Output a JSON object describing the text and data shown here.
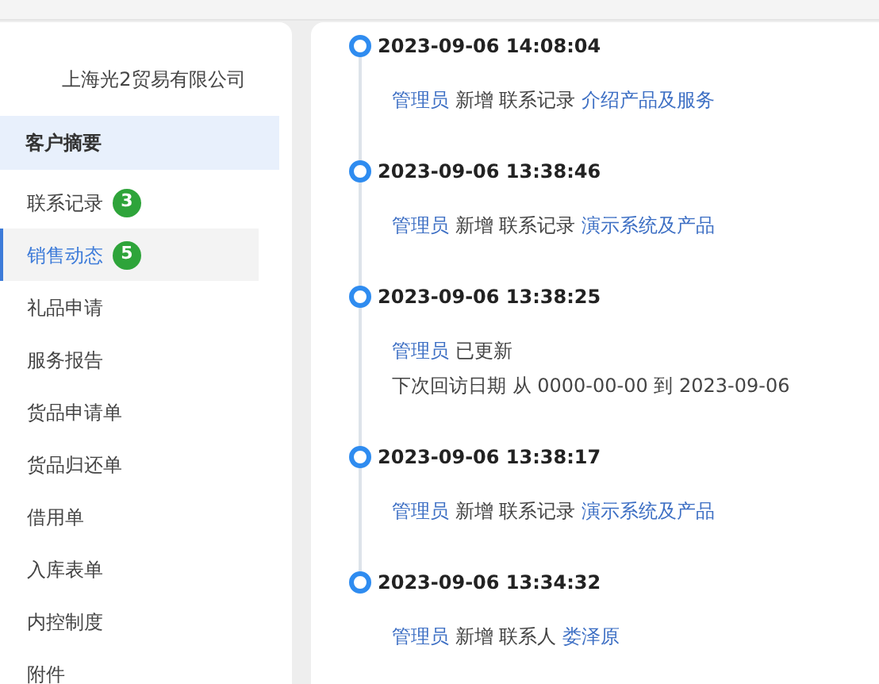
{
  "sidebar": {
    "company": "上海光2贸易有限公司",
    "summary": "客户摘要",
    "items": [
      {
        "label": "联系记录",
        "badge": "3",
        "selected": false
      },
      {
        "label": "销售动态",
        "badge": "5",
        "selected": true
      },
      {
        "label": "礼品申请",
        "selected": false
      },
      {
        "label": "服务报告",
        "selected": false
      },
      {
        "label": "货品申请单",
        "selected": false
      },
      {
        "label": "货品归还单",
        "selected": false
      },
      {
        "label": "借用单",
        "selected": false
      },
      {
        "label": "入库表单",
        "selected": false
      },
      {
        "label": "内控制度",
        "selected": false
      },
      {
        "label": "附件",
        "selected": false
      }
    ]
  },
  "timeline": [
    {
      "time": "2023-09-06 14:08:04",
      "lines": [
        [
          {
            "kind": "link",
            "text": "管理员"
          },
          {
            "kind": "plain",
            "text": "新增 联系记录"
          },
          {
            "kind": "link",
            "text": "介绍产品及服务"
          }
        ]
      ]
    },
    {
      "time": "2023-09-06 13:38:46",
      "lines": [
        [
          {
            "kind": "link",
            "text": "管理员"
          },
          {
            "kind": "plain",
            "text": "新增 联系记录"
          },
          {
            "kind": "link",
            "text": "演示系统及产品"
          }
        ]
      ]
    },
    {
      "time": "2023-09-06 13:38:25",
      "lines": [
        [
          {
            "kind": "link",
            "text": "管理员"
          },
          {
            "kind": "plain",
            "text": "已更新"
          }
        ],
        [
          {
            "kind": "plain",
            "text": "下次回访日期 从 0000-00-00 到 2023-09-06"
          }
        ]
      ]
    },
    {
      "time": "2023-09-06 13:38:17",
      "lines": [
        [
          {
            "kind": "link",
            "text": "管理员"
          },
          {
            "kind": "plain",
            "text": "新增 联系记录"
          },
          {
            "kind": "link",
            "text": "演示系统及产品"
          }
        ]
      ]
    },
    {
      "time": "2023-09-06 13:34:32",
      "lines": [
        [
          {
            "kind": "link",
            "text": "管理员"
          },
          {
            "kind": "plain",
            "text": "新增 联系人"
          },
          {
            "kind": "link",
            "text": "娄泽原"
          }
        ]
      ]
    }
  ]
}
